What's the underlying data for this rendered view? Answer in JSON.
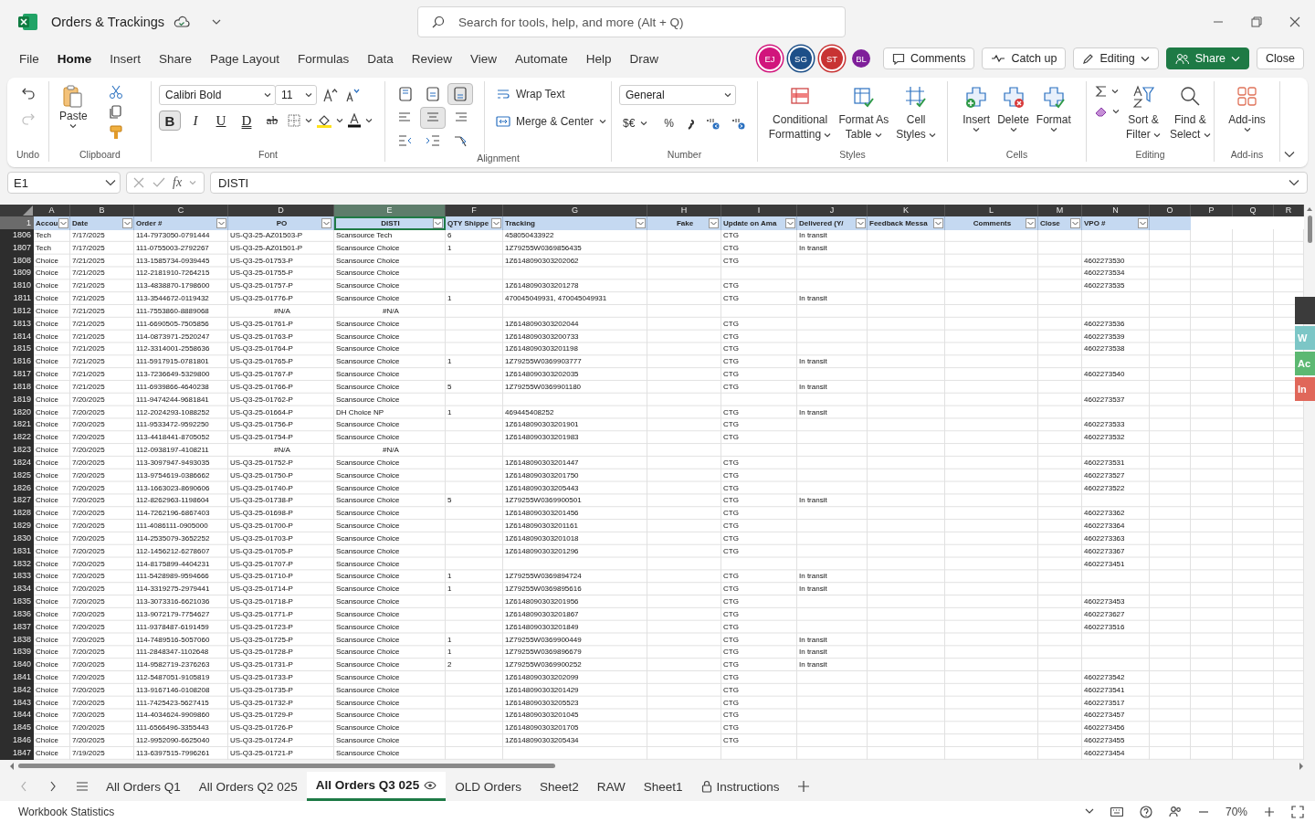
{
  "window": {
    "title": "Orders & Trackings",
    "search_placeholder": "Search for tools, help, and more (Alt + Q)"
  },
  "menu": [
    {
      "text": "File",
      "selected": false
    },
    {
      "text": "Home",
      "selected": true
    },
    {
      "text": "Insert",
      "selected": false
    },
    {
      "text": "Share",
      "selected": false
    },
    {
      "text": "Page Layout",
      "selected": false
    },
    {
      "text": "Formulas",
      "selected": false
    },
    {
      "text": "Data",
      "selected": false
    },
    {
      "text": "Review",
      "selected": false
    },
    {
      "text": "View",
      "selected": false
    },
    {
      "text": "Automate",
      "selected": false
    },
    {
      "text": "Help",
      "selected": false
    },
    {
      "text": "Draw",
      "selected": false
    }
  ],
  "collaborators": [
    {
      "initials": "EJ",
      "color": "#d1157c",
      "ring": true
    },
    {
      "initials": "SG",
      "color": "#1d4f88",
      "ring": true
    },
    {
      "initials": "ST",
      "color": "#c83333",
      "ring": true
    },
    {
      "initials": "BL",
      "color": "#7f1f9a",
      "ring": false
    }
  ],
  "actions": [
    {
      "text": "Comments",
      "kind": "comments"
    },
    {
      "text": "Catch up",
      "kind": "catchup"
    },
    {
      "text": "Editing",
      "kind": "editing"
    },
    {
      "text": "Share",
      "kind": "share"
    },
    {
      "text": "Close",
      "kind": "close"
    }
  ],
  "ribbon": {
    "undo": {
      "label": "Undo",
      "redo_disabled": true
    },
    "clipboard": {
      "label": "Clipboard",
      "paste": "Paste"
    },
    "font": {
      "label": "Font",
      "name": "Calibri Bold",
      "size": "11",
      "styles": [
        {
          "text": "B",
          "selected": true
        },
        {
          "text": "I",
          "selected": false
        },
        {
          "text": "U",
          "selected": false
        },
        {
          "text": "D",
          "selected": false
        },
        {
          "text": "ab",
          "selected": false
        }
      ]
    },
    "alignment": {
      "label": "Alignment",
      "buttons": [
        {
          "selected": false
        },
        {
          "selected": false
        },
        {
          "selected": true
        },
        {
          "selected": false
        },
        {
          "selected": true
        },
        {
          "selected": false
        },
        {
          "selected": false
        },
        {
          "selected": false
        },
        {
          "selected": false
        }
      ],
      "wrap": "Wrap Text",
      "merge": "Merge & Center"
    },
    "number": {
      "label": "Number",
      "format": "General",
      "currency": "$€",
      "percent": "%"
    },
    "styles": {
      "label": "Styles",
      "buttons": [
        {
          "lines": [
            "Conditional",
            "Formatting"
          ]
        },
        {
          "lines": [
            "Format As",
            "Table"
          ]
        },
        {
          "lines": [
            "Cell",
            "Styles"
          ]
        }
      ]
    },
    "cells": {
      "label": "Cells",
      "buttons": [
        {
          "lines": [
            "Insert"
          ]
        },
        {
          "lines": [
            "Delete"
          ]
        },
        {
          "lines": [
            "Format"
          ]
        }
      ]
    },
    "editing": {
      "label": "Editing",
      "buttons": [
        {
          "lines": [
            "Sort &",
            "Filter"
          ]
        },
        {
          "lines": [
            "Find &",
            "Select"
          ]
        }
      ]
    },
    "addins": {
      "label": "Add-ins",
      "button": "Add-ins"
    }
  },
  "formula_bar": {
    "cell": "E1",
    "fx": "fx",
    "value": "DISTI"
  },
  "sheet": {
    "column_letters": [
      {
        "text": "A",
        "selected": false
      },
      {
        "text": "B",
        "selected": false
      },
      {
        "text": "C",
        "selected": false
      },
      {
        "text": "D",
        "selected": false
      },
      {
        "text": "E",
        "selected": true
      },
      {
        "text": "F",
        "selected": false
      },
      {
        "text": "G",
        "selected": false
      },
      {
        "text": "H",
        "selected": false
      },
      {
        "text": "I",
        "selected": false
      },
      {
        "text": "J",
        "selected": false
      },
      {
        "text": "K",
        "selected": false
      },
      {
        "text": "L",
        "selected": false
      },
      {
        "text": "M",
        "selected": false
      },
      {
        "text": "N",
        "selected": false
      },
      {
        "text": "O",
        "selected": false
      },
      {
        "text": "P",
        "selected": false
      },
      {
        "text": "Q",
        "selected": false
      },
      {
        "text": "R",
        "selected": false
      }
    ],
    "header_row": {
      "number": "1",
      "selected": true
    },
    "columns": [
      "Accou",
      "Date",
      "Order #",
      "PO",
      "DISTI",
      "QTY Shippe",
      "Tracking",
      "Fake",
      "Update on Ama",
      "Delivered (Y/",
      "Feedback Messa",
      "Comments",
      "Close",
      "VPO #"
    ],
    "rows": [
      {
        "r": "1806",
        "a": "Tech",
        "b": "7/17/2025",
        "c": "114-7973050-0791444",
        "d": "US-Q3-25-AZ01503-P",
        "e": "Scansource Tech",
        "f": "6",
        "g": "458050433922",
        "i": "CTG",
        "j": "In transit"
      },
      {
        "r": "1807",
        "a": "Tech",
        "b": "7/17/2025",
        "c": "111-0755003-2792267",
        "d": "US-Q3-25-AZ01501-P",
        "e": "Scansource Choice",
        "f": "1",
        "g": "1Z79255W0369856435",
        "i": "CTG",
        "j": "In transit"
      },
      {
        "r": "1808",
        "a": "Choice",
        "b": "7/21/2025",
        "c": "113-1585734-0939445",
        "d": "US-Q3-25-01753-P",
        "e": "Scansource Choice",
        "g": "1Z6148090303202062",
        "i": "CTG",
        "n": "4602273530"
      },
      {
        "r": "1809",
        "a": "Choice",
        "b": "7/21/2025",
        "c": "112-2181910-7264215",
        "d": "US-Q3-25-01755-P",
        "e": "Scansource Choice",
        "n": "4602273534"
      },
      {
        "r": "1810",
        "a": "Choice",
        "b": "7/21/2025",
        "c": "113-4838870-1798600",
        "d": "US-Q3-25-01757-P",
        "e": "Scansource Choice",
        "g": "1Z6148090303201278",
        "i": "CTG",
        "n": "4602273535"
      },
      {
        "r": "1811",
        "a": "Choice",
        "b": "7/21/2025",
        "c": "113-3544672-0119432",
        "d": "US-Q3-25-01776-P",
        "e": "Scansource Choice",
        "f": "1",
        "g": "470045049931, 470045049931",
        "i": "CTG",
        "j": "In transit"
      },
      {
        "r": "1812",
        "a": "Choice",
        "b": "7/21/2025",
        "c": "111-7553860-8889068",
        "d": {
          "text": "#N/A",
          "kind": "error"
        },
        "e": {
          "text": "#N/A",
          "kind": "error"
        }
      },
      {
        "r": "1813",
        "a": "Choice",
        "b": "7/21/2025",
        "c": "111-6690505-7505856",
        "d": "US-Q3-25-01761-P",
        "e": "Scansource Choice",
        "g": "1Z6148090303202044",
        "i": "CTG",
        "n": "4602273536"
      },
      {
        "r": "1814",
        "a": "Choice",
        "b": "7/21/2025",
        "c": "114-0873971-2520247",
        "d": "US-Q3-25-01763-P",
        "e": "Scansource Choice",
        "g": "1Z6148090303200733",
        "i": "CTG",
        "n": "4602273539"
      },
      {
        "r": "1815",
        "a": "Choice",
        "b": "7/21/2025",
        "c": "112-3314001-2558636",
        "d": "US-Q3-25-01764-P",
        "e": "Scansource Choice",
        "g": "1Z6148090303201198",
        "i": "CTG",
        "n": "4602273538"
      },
      {
        "r": "1816",
        "a": "Choice",
        "b": "7/21/2025",
        "c": "111-5917915-0781801",
        "d": "US-Q3-25-01765-P",
        "e": "Scansource Choice",
        "f": "1",
        "g": "1Z79255W0369903777",
        "i": "CTG",
        "j": "In transit"
      },
      {
        "r": "1817",
        "a": "Choice",
        "b": "7/21/2025",
        "c": "113-7236649-5329800",
        "d": "US-Q3-25-01767-P",
        "e": "Scansource Choice",
        "g": "1Z6148090303202035",
        "i": "CTG",
        "n": "4602273540"
      },
      {
        "r": "1818",
        "a": "Choice",
        "b": "7/21/2025",
        "c": "111-6939866-4640238",
        "d": "US-Q3-25-01766-P",
        "e": "Scansource Choice",
        "f": "5",
        "g": "1Z79255W0369901180",
        "i": "CTG",
        "j": "In transit"
      },
      {
        "r": "1819",
        "a": "Choice",
        "b": "7/20/2025",
        "c": "111-9474244-9681841",
        "d": "US-Q3-25-01762-P",
        "e": "Scansource Choice",
        "n": "4602273537"
      },
      {
        "r": "1820",
        "a": "Choice",
        "b": "7/20/2025",
        "c": "112-2024293-1088252",
        "d": "US-Q3-25-01664-P",
        "e": "DH Choice NP",
        "f": "1",
        "g": "469445408252",
        "i": "CTG",
        "j": "In transit"
      },
      {
        "r": "1821",
        "a": "Choice",
        "b": "7/20/2025",
        "c": "111-9533472-9592250",
        "d": "US-Q3-25-01756-P",
        "e": "Scansource Choice",
        "g": "1Z6148090303201901",
        "i": "CTG",
        "n": "4602273533"
      },
      {
        "r": "1822",
        "a": "Choice",
        "b": "7/20/2025",
        "c": "113-4418441-8705052",
        "d": "US-Q3-25-01754-P",
        "e": "Scansource Choice",
        "g": "1Z6148090303201983",
        "i": "CTG",
        "n": "4602273532"
      },
      {
        "r": "1823",
        "a": "Choice",
        "b": "7/20/2025",
        "c": "112-0938197-4108211",
        "d": {
          "text": "#N/A",
          "kind": "error"
        },
        "e": {
          "text": "#N/A",
          "kind": "error"
        }
      },
      {
        "r": "1824",
        "a": "Choice",
        "b": "7/20/2025",
        "c": "113-3097947-9493035",
        "d": "US-Q3-25-01752-P",
        "e": "Scansource Choice",
        "g": "1Z6148090303201447",
        "i": "CTG",
        "n": "4602273531"
      },
      {
        "r": "1825",
        "a": "Choice",
        "b": "7/20/2025",
        "c": "113-9754619-0386662",
        "d": "US-Q3-25-01750-P",
        "e": "Scansource Choice",
        "g": "1Z6148090303201750",
        "i": "CTG",
        "n": "4602273527"
      },
      {
        "r": "1826",
        "a": "Choice",
        "b": "7/20/2025",
        "c": "113-1663023-8690606",
        "d": "US-Q3-25-01740-P",
        "e": "Scansource Choice",
        "g": "1Z6148090303205443",
        "i": "CTG",
        "n": "4602273522"
      },
      {
        "r": "1827",
        "a": "Choice",
        "b": "7/20/2025",
        "c": "112-8262963-1198604",
        "d": "US-Q3-25-01738-P",
        "e": "Scansource Choice",
        "f": "5",
        "g": "1Z79255W0369900501",
        "i": "CTG",
        "j": "In transit"
      },
      {
        "r": "1828",
        "a": "Choice",
        "b": "7/20/2025",
        "c": "114-7262196-6867403",
        "d": "US-Q3-25-01698-P",
        "e": "Scansource Choice",
        "g": "1Z6148090303201456",
        "i": "CTG",
        "n": "4602273362"
      },
      {
        "r": "1829",
        "a": "Choice",
        "b": "7/20/2025",
        "c": "111-4086111-0905000",
        "d": "US-Q3-25-01700-P",
        "e": "Scansource Choice",
        "g": "1Z6148090303201161",
        "i": "CTG",
        "n": "4602273364"
      },
      {
        "r": "1830",
        "a": "Choice",
        "b": "7/20/2025",
        "c": "114-2535079-3652252",
        "d": "US-Q3-25-01703-P",
        "e": "Scansource Choice",
        "g": "1Z6148090303201018",
        "i": "CTG",
        "n": "4602273363"
      },
      {
        "r": "1831",
        "a": "Choice",
        "b": "7/20/2025",
        "c": "112-1456212-6278607",
        "d": "US-Q3-25-01705-P",
        "e": "Scansource Choice",
        "g": "1Z6148090303201296",
        "i": "CTG",
        "n": "4602273367"
      },
      {
        "r": "1832",
        "a": "Choice",
        "b": "7/20/2025",
        "c": "114-8175899-4404231",
        "d": "US-Q3-25-01707-P",
        "e": "Scansource Choice",
        "n": "4602273451"
      },
      {
        "r": "1833",
        "a": "Choice",
        "b": "7/20/2025",
        "c": "111-5428989-9594666",
        "d": "US-Q3-25-01710-P",
        "e": "Scansource Choice",
        "f": "1",
        "g": "1Z79255W0369894724",
        "i": "CTG",
        "j": "In transit"
      },
      {
        "r": "1834",
        "a": "Choice",
        "b": "7/20/2025",
        "c": "114-3319275-2979441",
        "d": "US-Q3-25-01714-P",
        "e": "Scansource Choice",
        "f": "1",
        "g": "1Z79255W0369895616",
        "i": "CTG",
        "j": "In transit"
      },
      {
        "r": "1835",
        "a": "Choice",
        "b": "7/20/2025",
        "c": "113-3073316-6621036",
        "d": "US-Q3-25-01718-P",
        "e": "Scansource Choice",
        "g": "1Z6148090303201956",
        "i": "CTG",
        "n": "4602273453"
      },
      {
        "r": "1836",
        "a": "Choice",
        "b": "7/20/2025",
        "c": "113-9072179-7754627",
        "d": "US-Q3-25-01771-P",
        "e": "Scansource Choice",
        "g": "1Z6148090303201867",
        "i": "CTG",
        "n": "4602273627"
      },
      {
        "r": "1837",
        "a": "Choice",
        "b": "7/20/2025",
        "c": "111-9378487-6191459",
        "d": "US-Q3-25-01723-P",
        "e": "Scansource Choice",
        "g": "1Z6148090303201849",
        "i": "CTG",
        "n": "4602273516"
      },
      {
        "r": "1838",
        "a": "Choice",
        "b": "7/20/2025",
        "c": "114-7489516-5057060",
        "d": "US-Q3-25-01725-P",
        "e": "Scansource Choice",
        "f": "1",
        "g": "1Z79255W0369900449",
        "i": "CTG",
        "j": "In transit"
      },
      {
        "r": "1839",
        "a": "Choice",
        "b": "7/20/2025",
        "c": "111-2848347-1102648",
        "d": "US-Q3-25-01728-P",
        "e": "Scansource Choice",
        "f": "1",
        "g": "1Z79255W0369896679",
        "i": "CTG",
        "j": "In transit"
      },
      {
        "r": "1840",
        "a": "Choice",
        "b": "7/20/2025",
        "c": "114-9582719-2376263",
        "d": "US-Q3-25-01731-P",
        "e": "Scansource Choice",
        "f": "2",
        "g": "1Z79255W0369900252",
        "i": "CTG",
        "j": "In transit"
      },
      {
        "r": "1841",
        "a": "Choice",
        "b": "7/20/2025",
        "c": "112-5487051-9105819",
        "d": "US-Q3-25-01733-P",
        "e": "Scansource Choice",
        "g": "1Z6148090303202099",
        "i": "CTG",
        "n": "4602273542"
      },
      {
        "r": "1842",
        "a": "Choice",
        "b": "7/20/2025",
        "c": "113-9167146-0108208",
        "d": "US-Q3-25-01735-P",
        "e": "Scansource Choice",
        "g": "1Z6148090303201429",
        "i": "CTG",
        "n": "4602273541"
      },
      {
        "r": "1843",
        "a": "Choice",
        "b": "7/20/2025",
        "c": "111-7425423-5627415",
        "d": "US-Q3-25-01732-P",
        "e": "Scansource Choice",
        "g": "1Z6148090303205523",
        "i": "CTG",
        "n": "4602273517"
      },
      {
        "r": "1844",
        "a": "Choice",
        "b": "7/20/2025",
        "c": "114-4034624-9909860",
        "d": "US-Q3-25-01729-P",
        "e": "Scansource Choice",
        "g": "1Z6148090303201045",
        "i": "CTG",
        "n": "4602273457"
      },
      {
        "r": "1845",
        "a": "Choice",
        "b": "7/20/2025",
        "c": "111-6566496-3355443",
        "d": "US-Q3-25-01726-P",
        "e": "Scansource Choice",
        "g": "1Z6148090303201705",
        "i": "CTG",
        "n": "4602273456"
      },
      {
        "r": "1846",
        "a": "Choice",
        "b": "7/20/2025",
        "c": "112-9952090-6625040",
        "d": "US-Q3-25-01724-P",
        "e": "Scansource Choice",
        "g": "1Z6148090303205434",
        "i": "CTG",
        "n": "4602273455"
      },
      {
        "r": "1847",
        "a": "Choice",
        "b": "7/19/2025",
        "c": "113-6397515-7996261",
        "d": "US-Q3-25-01721-P",
        "e": "Scansource Choice",
        "n": "4602273454"
      }
    ]
  },
  "side_tabs": [
    {
      "text": "W",
      "color": "#7cc6c6"
    },
    {
      "text": "Ac",
      "color": "#5cb872"
    },
    {
      "text": "In",
      "color": "#e0675a"
    }
  ],
  "sheet_tabs": [
    {
      "text": "All Orders Q1",
      "selected": false,
      "kind": "plain"
    },
    {
      "text": "All Orders Q2 025",
      "selected": false,
      "kind": "plain"
    },
    {
      "text": "All Orders Q3 025",
      "selected": true,
      "kind": "viewed"
    },
    {
      "text": "OLD Orders",
      "selected": false,
      "kind": "plain"
    },
    {
      "text": "Sheet2",
      "selected": false,
      "kind": "plain"
    },
    {
      "text": "RAW",
      "selected": false,
      "kind": "plain"
    },
    {
      "text": "Sheet1",
      "selected": false,
      "kind": "plain"
    },
    {
      "text": "Instructions",
      "selected": false,
      "kind": "locked"
    }
  ],
  "status_bar": {
    "left": "Workbook Statistics",
    "zoom": "70%"
  }
}
